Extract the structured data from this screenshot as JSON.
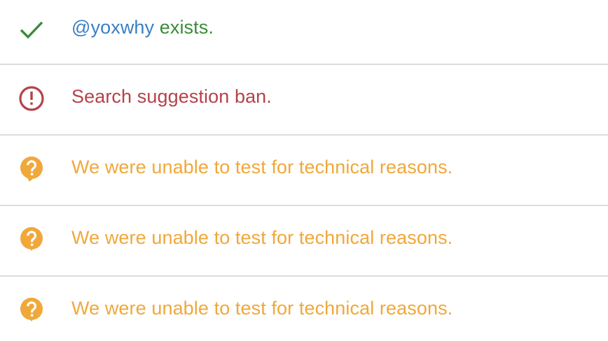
{
  "colors": {
    "success": "#3c8a3a",
    "handle": "#3b7fc4",
    "error": "#b5424a",
    "warning": "#f0a83a",
    "divider": "#dcdcdc"
  },
  "results": [
    {
      "icon": "check-icon",
      "handle": "@yoxwhy",
      "text": " exists.",
      "status": "success"
    },
    {
      "icon": "alert-circle-icon",
      "text": "Search suggestion ban.",
      "status": "error"
    },
    {
      "icon": "question-bubble-icon",
      "text": "We were unable to test for technical reasons.",
      "status": "warning"
    },
    {
      "icon": "question-bubble-icon",
      "text": "We were unable to test for technical reasons.",
      "status": "warning"
    },
    {
      "icon": "question-bubble-icon",
      "text": "We were unable to test for technical reasons.",
      "status": "warning"
    }
  ]
}
